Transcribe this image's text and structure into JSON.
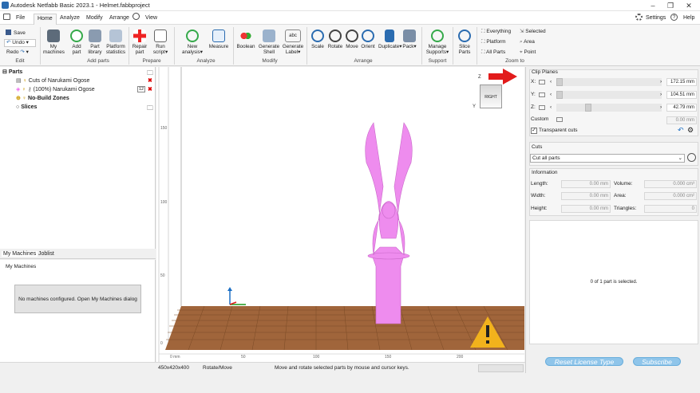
{
  "window": {
    "title": "Autodesk Netfabb Basic 2023.1 - Helmet.fabbproject",
    "minimize": "–",
    "maximize": "❐",
    "close": "✕"
  },
  "tabs": {
    "file": "File",
    "home": "Home",
    "analyze": "Analyze",
    "modify": "Modify",
    "arrange": "Arrange",
    "view": "View",
    "settings": "Settings",
    "help": "Help"
  },
  "ribbon": {
    "edit": {
      "save": "Save",
      "undo": "Undo",
      "redo": "Redo",
      "group": "Edit"
    },
    "addparts": {
      "my_machines_1": "My",
      "my_machines_2": "machines",
      "add_part_1": "Add",
      "add_part_2": "part",
      "part_library_1": "Part",
      "part_library_2": "library",
      "platform_stats_1": "Platform",
      "platform_stats_2": "statistics",
      "group": "Add parts"
    },
    "prepare": {
      "repair_1": "Repair",
      "repair_2": "part",
      "run_script_1": "Run",
      "run_script_2": "script",
      "group": "Prepare"
    },
    "analyze": {
      "new_analysis_1": "New",
      "new_analysis_2": "analysis",
      "measure": "Measure",
      "group": "Analyze"
    },
    "modify": {
      "boolean": "Boolean",
      "gen_shell_1": "Generate",
      "gen_shell_2": "Shell",
      "gen_label_1": "Generate",
      "gen_label_2": "Label",
      "group": "Modify"
    },
    "arrange": {
      "scale": "Scale",
      "rotate": "Rotate",
      "move": "Move",
      "orient": "Orient",
      "duplicate": "Duplicate",
      "pack": "Pack",
      "group": "Arrange"
    },
    "support": {
      "manage_1": "Manage",
      "manage_2": "Supports",
      "group": "Support"
    },
    "slice": {
      "slice_1": "Slice",
      "slice_2": "Parts"
    },
    "zoom": {
      "everything": "Everything",
      "selected": "Selected",
      "platform": "Platform",
      "area": "Area",
      "all_parts": "All Parts",
      "point": "Point",
      "group": "Zoom to"
    }
  },
  "parts_tree": {
    "root": "Parts",
    "cuts": "Cuts of Narukami Ogose",
    "part": "(100%) Narukami Ogose",
    "part_badge": "12",
    "no_build": "No-Build Zones",
    "slices": "Slices"
  },
  "machines": {
    "tab1": "My Machines",
    "tab2": "Joblist",
    "header": "My Machines",
    "message": "No machines configured. Open My Machines dialog"
  },
  "viewport": {
    "cube_label": "RIGHT",
    "axis_z": "Z",
    "axis_y": "Y",
    "axis_x": "X",
    "ticks_x": [
      "0 mm",
      "50",
      "100",
      "150",
      "200"
    ],
    "ticks_y": [
      "150",
      "100",
      "50",
      "0"
    ]
  },
  "status": {
    "size": "450x420x400",
    "mode": "Rotate/Move",
    "hint": "Move and rotate selected parts by mouse and cursor keys."
  },
  "clip": {
    "title": "Clip Planes",
    "x_label": "X:",
    "x_val": "172.15 mm",
    "y_label": "Y:",
    "y_val": "104.51 mm",
    "z_label": "Z:",
    "z_val": "42.79 mm",
    "custom": "Custom",
    "custom_val": "0.00 mm",
    "transparent": "Transparent cuts"
  },
  "cuts": {
    "title": "Cuts",
    "select": "Cut all parts"
  },
  "info": {
    "title": "Information",
    "length": "Length:",
    "length_v": "0.00 mm",
    "volume": "Volume:",
    "volume_v": "0.000 cm³",
    "width": "Width:",
    "width_v": "0.00 mm",
    "area": "Area:",
    "area_v": "0.000 cm²",
    "height": "Height:",
    "height_v": "0.00 mm",
    "triangles": "Triangles:",
    "triangles_v": "0"
  },
  "selection": "0 of 1 part is selected.",
  "license": {
    "reset": "Reset License Type",
    "subscribe": "Subscribe"
  },
  "colors": {
    "part": "#ee8cee",
    "floor": "#a0653b",
    "accent": "#1c6fc4",
    "warning": "#f2b21c",
    "arrow": "#e21b1b"
  }
}
